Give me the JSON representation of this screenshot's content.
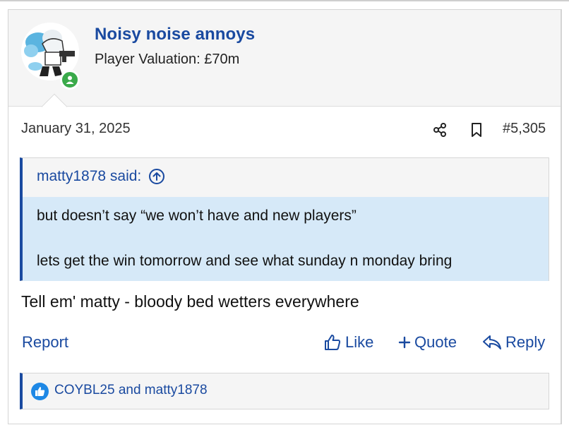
{
  "post": {
    "username": "Noisy noise annoys",
    "user_title": "Player Valuation: £70m",
    "date": "January 31, 2025",
    "number": "#5,305",
    "quote": {
      "author": "matty1878 said:",
      "lines": [
        "but doesn’t say “we won’t have and new players”",
        "lets get the win tomorrow and see what sunday n monday bring"
      ]
    },
    "body": "Tell em' matty - bloody bed wetters everywhere",
    "actions": {
      "report": "Report",
      "like": "Like",
      "quote": "Quote",
      "reply": "Reply"
    },
    "reactions": "COYBL25 and matty1878"
  },
  "colors": {
    "link": "#1a4aa0",
    "quote_bg": "#d6e9f8",
    "online": "#3aaa4a",
    "like_badge": "#1e88e5"
  },
  "icons": [
    "share-icon",
    "bookmark-icon",
    "arrow-up-circle-icon",
    "thumbs-up-icon",
    "plus-icon",
    "reply-arrow-icon",
    "like-reaction-icon",
    "online-status-icon"
  ]
}
